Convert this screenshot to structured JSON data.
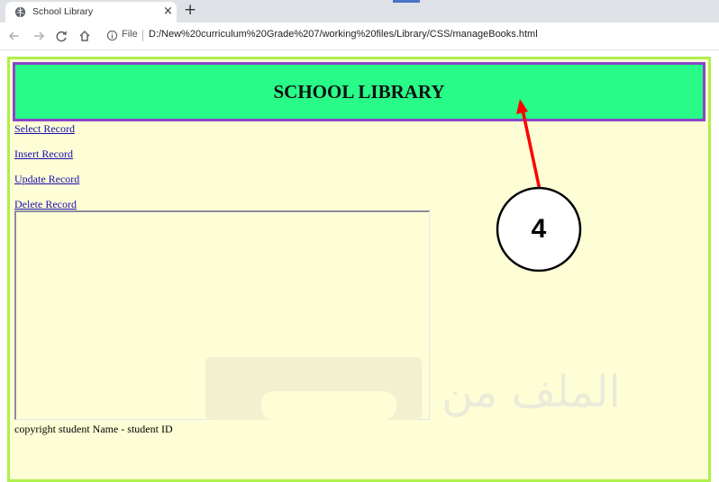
{
  "browser": {
    "tab": {
      "title": "School Library",
      "close_glyph": "×",
      "favicon": "globe-icon"
    },
    "new_tab_glyph": "+",
    "address": {
      "scheme_label": "File",
      "url": "D:/New%20curriculum%20Grade%207/working%20files/Library/CSS/manageBooks.html"
    },
    "nav_icons": [
      "back-arrow-icon",
      "forward-arrow-icon",
      "reload-icon",
      "home-icon",
      "info-icon"
    ]
  },
  "page": {
    "banner_title": "SCHOOL LIBRARY",
    "menu": [
      {
        "label": "Select Record"
      },
      {
        "label": "Insert Record"
      },
      {
        "label": "Update Record"
      },
      {
        "label": "Delete Record"
      }
    ],
    "footer": "copyright student Name - student ID",
    "colors": {
      "background": "#fefed6",
      "outer_border": "#aef04a",
      "banner_fill": "#29fb88",
      "banner_border": "#8a45c9",
      "link": "#1a0dab"
    }
  },
  "annotation": {
    "label": "4",
    "arrow_color": "#ff0000"
  },
  "watermark": {
    "text": "الملف من"
  }
}
